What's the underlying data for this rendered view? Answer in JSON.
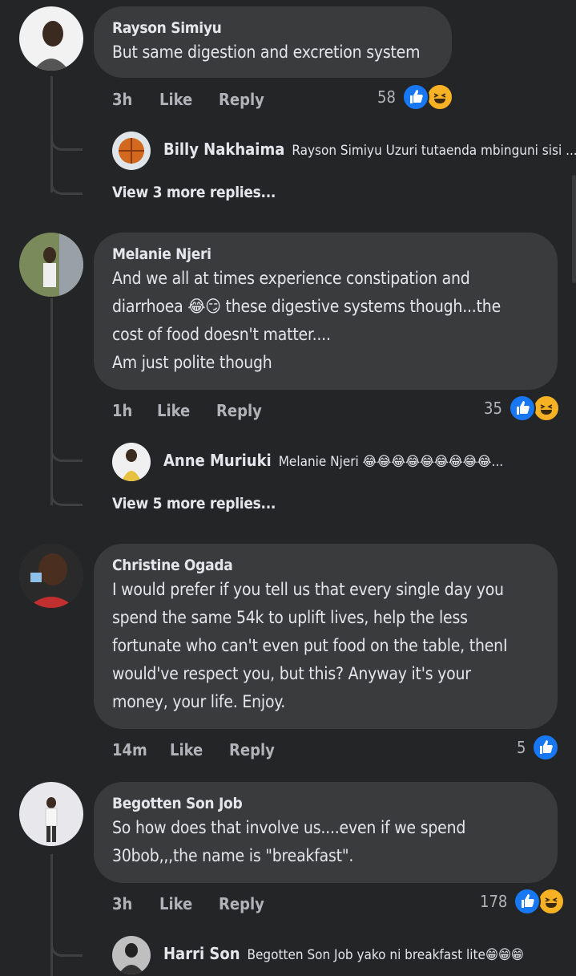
{
  "comments": [
    {
      "author": "Rayson Simiyu",
      "lines": [
        "But same digestion and excretion system"
      ],
      "time": "3h",
      "like_label": "Like",
      "reply_label": "Reply",
      "reaction_count": "58",
      "reactions": [
        "like-icon",
        "haha-icon"
      ],
      "reply": {
        "author": "Billy Nakhaima",
        "text": "Rayson Simiyu Uzuri tutaenda mbinguni sisi ..."
      },
      "more_replies": "View 3 more replies..."
    },
    {
      "author": "Melanie Njeri",
      "lines": [
        "And we all at times experience constipation and",
        "diarrhoea 😂😏 these digestive systems though...the",
        "cost of food doesn't matter....",
        "Am just polite though"
      ],
      "time": "1h",
      "like_label": "Like",
      "reply_label": "Reply",
      "reaction_count": "35",
      "reactions": [
        "like-icon",
        "haha-icon"
      ],
      "reply": {
        "author": "Anne Muriuki",
        "text": "Melanie Njeri 😂😂😂😂😂😂😂😂😂..."
      },
      "more_replies": "View 5 more replies..."
    },
    {
      "author": "Christine Ogada",
      "lines": [
        "I would prefer if you tell us that every single day you",
        "spend the same 54k to uplift lives, help the less",
        "fortunate who can't even put food on the table, thenI",
        "would've respect you, but this? Anyway it's your",
        "money, your life. Enjoy."
      ],
      "time": "14m",
      "like_label": "Like",
      "reply_label": "Reply",
      "reaction_count": "5",
      "reactions": [
        "like-icon"
      ]
    },
    {
      "author": "Begotten Son Job",
      "lines": [
        "So how does that involve us....even if we spend",
        "30bob,,,the name is \"breakfast\"."
      ],
      "time": "3h",
      "like_label": "Like",
      "reply_label": "Reply",
      "reaction_count": "178",
      "reactions": [
        "like-icon",
        "haha-icon"
      ],
      "reply": {
        "author": "Harri Son",
        "text": "Begotten Son Job yako ni breakfast lite😁😁😁"
      }
    }
  ],
  "colors": {
    "background": "#242526",
    "bubble": "#3a3b3c",
    "like": "#1877f2",
    "haha": "#f7b125",
    "secondary_text": "#b0b3b8"
  }
}
